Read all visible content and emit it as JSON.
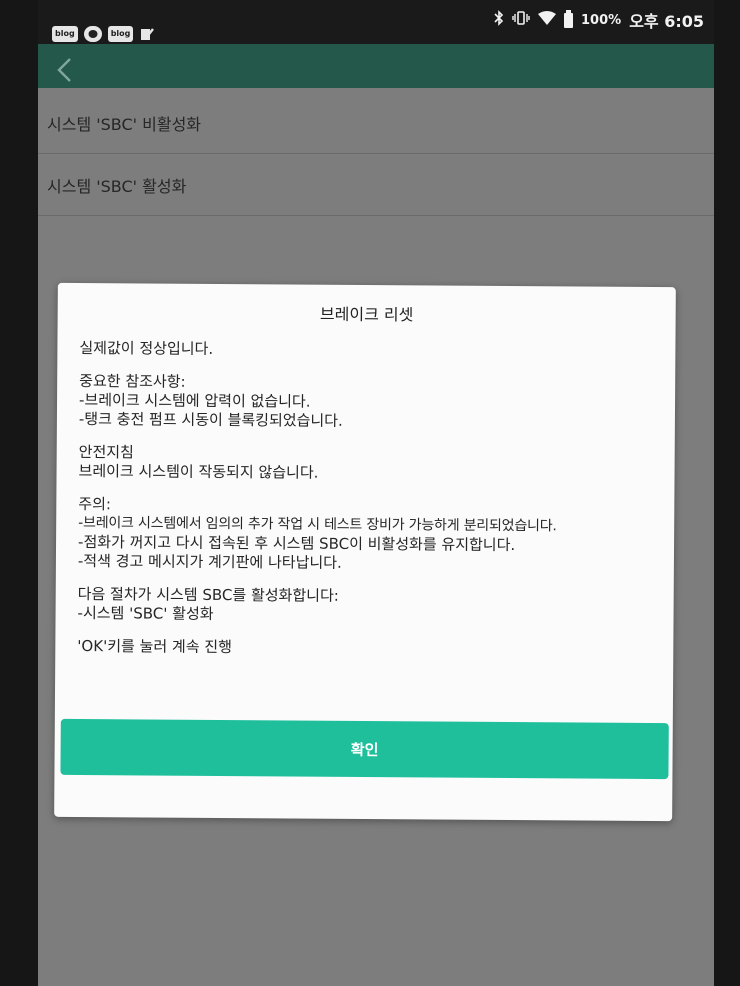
{
  "status_bar": {
    "notification_icons": [
      "blog",
      "chat",
      "blog",
      "check"
    ],
    "battery": "100%",
    "time": "오후 6:05"
  },
  "list": {
    "items": [
      "시스템 'SBC' 비활성화",
      "시스템 'SBC' 활성화"
    ]
  },
  "dialog": {
    "title": "브레이크 리셋",
    "paragraphs": [
      [
        "실제값이 정상입니다."
      ],
      [
        "중요한 참조사항:",
        "-브레이크 시스템에 압력이 없습니다.",
        "-탱크 충전 펌프 시동이 블록킹되었습니다."
      ],
      [
        "안전지침",
        "브레이크 시스템이 작동되지 않습니다."
      ],
      [
        "주의:",
        "-브레이크 시스템에서 임의의 추가 작업 시 테스트 장비가 가능하게 분리되었습니다.",
        "-점화가 꺼지고 다시 접속된 후 시스템 SBC이 비활성화를 유지합니다.",
        "-적색 경고 메시지가 계기판에 나타납니다."
      ],
      [
        "다음 절차가 시스템 SBC를 활성화합니다:",
        "-시스템 'SBC' 활성화"
      ],
      [
        "'OK'키를 눌러 계속 진행"
      ]
    ],
    "confirm_label": "확인"
  },
  "colors": {
    "app_bar": "#24584b",
    "confirm_button": "#1fbf9c",
    "dim_overlay": "#7d7d7d"
  }
}
